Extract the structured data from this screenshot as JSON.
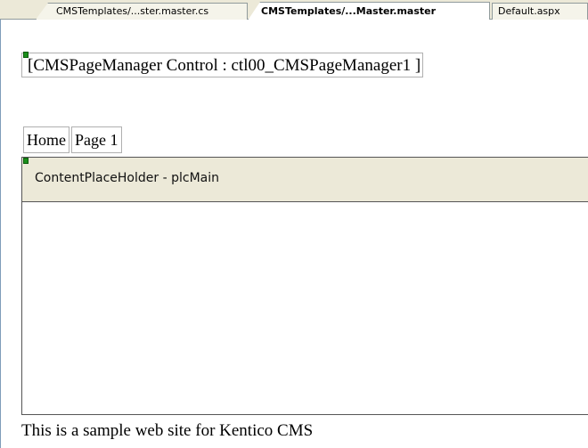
{
  "tabs": [
    {
      "label": "CMSTemplates/...ster.master.cs",
      "active": false
    },
    {
      "label": "CMSTemplates/...Master.master",
      "active": true
    },
    {
      "label": "Default.aspx",
      "active": false
    }
  ],
  "designer": {
    "page_manager_label": "CMSPageManager Control : ctl00_CMSPageManager1 ]",
    "menu_items": [
      "Home",
      "Page 1"
    ],
    "placeholder_title": "ContentPlaceHolder - plcMain",
    "footer_text": "This is a sample web site for Kentico CMS"
  },
  "colors": {
    "tabstrip_bg": "#ece9d8",
    "placeholder_header_bg": "#ece9d8",
    "control_glyph": "#1a8f1a"
  }
}
